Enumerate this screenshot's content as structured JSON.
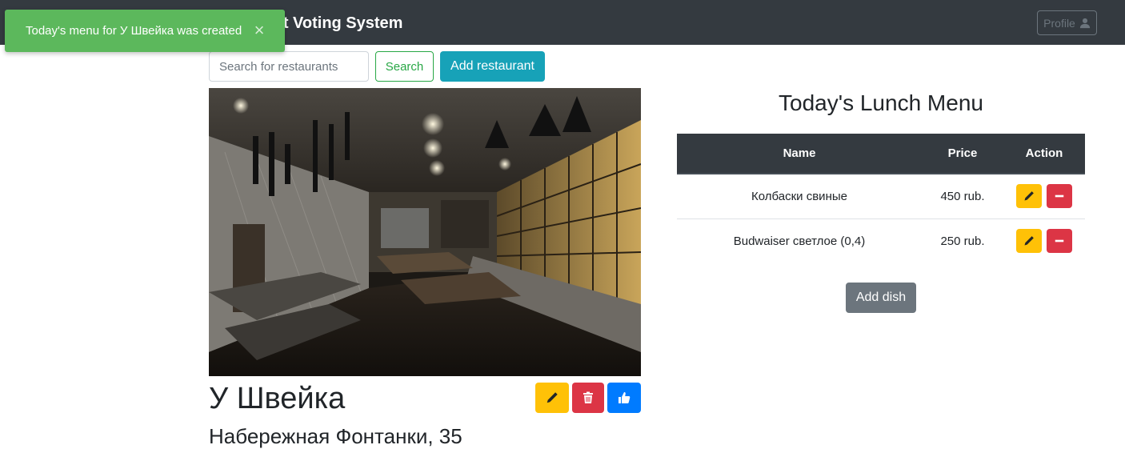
{
  "navbar": {
    "brand": "Restaurant Voting System",
    "profile_label": "Profile"
  },
  "toast": {
    "message": "Today's menu for У Швейка was created",
    "close_symbol": "×"
  },
  "search": {
    "placeholder": "Search for restaurants",
    "value": "",
    "button_label": "Search"
  },
  "actions": {
    "add_restaurant_label": "Add restaurant",
    "add_dish_label": "Add dish"
  },
  "restaurant": {
    "name": "У Швейка",
    "address": "Набережная Фонтанки, 35",
    "buttons": [
      "pencil-icon",
      "trash-icon",
      "thumbs-up-icon"
    ]
  },
  "menu": {
    "title": "Today's Lunch Menu",
    "columns": [
      "Name",
      "Price",
      "Action"
    ],
    "rows": [
      {
        "name": "Колбаски свиные",
        "price": "450 rub."
      },
      {
        "name": "Budwaiser светлое (0,4)",
        "price": "250 rub."
      }
    ]
  },
  "colors": {
    "navbar": "#343a40",
    "toast_success": "#5cb85c",
    "warning": "#ffc107",
    "danger": "#dc3545",
    "primary": "#007bff",
    "info": "#17a2b8",
    "secondary": "#6c757d",
    "success": "#28a745"
  }
}
